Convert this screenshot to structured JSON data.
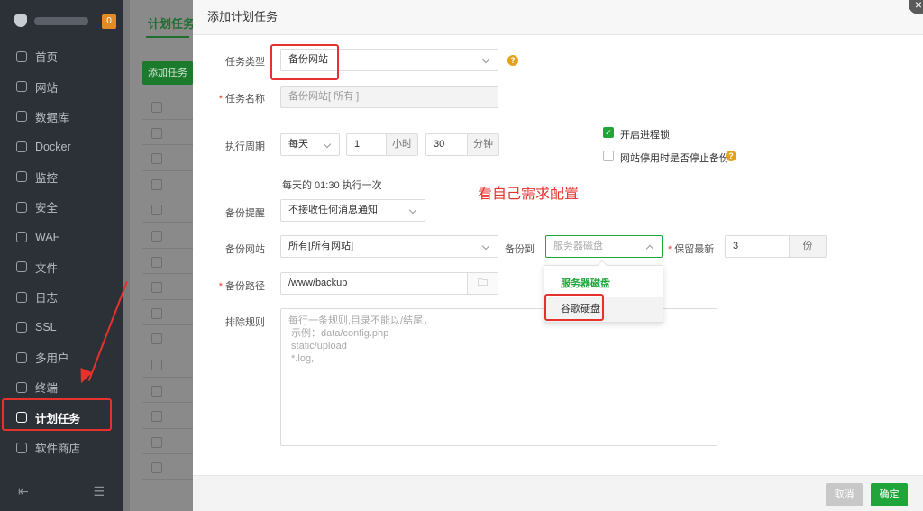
{
  "sidebar": {
    "badge": "0",
    "items": [
      {
        "label": "首页",
        "icon": "home-icon"
      },
      {
        "label": "网站",
        "icon": "globe-icon"
      },
      {
        "label": "数据库",
        "icon": "database-icon"
      },
      {
        "label": "Docker",
        "icon": "docker-icon"
      },
      {
        "label": "监控",
        "icon": "monitor-icon"
      },
      {
        "label": "安全",
        "icon": "shield-icon"
      },
      {
        "label": "WAF",
        "icon": "waf-icon"
      },
      {
        "label": "文件",
        "icon": "folder-icon"
      },
      {
        "label": "日志",
        "icon": "log-icon"
      },
      {
        "label": "SSL",
        "icon": "ssl-icon"
      },
      {
        "label": "多用户",
        "icon": "users-icon"
      },
      {
        "label": "终端",
        "icon": "terminal-icon"
      },
      {
        "label": "计划任务",
        "icon": "calendar-icon"
      },
      {
        "label": "软件商店",
        "icon": "store-icon"
      }
    ],
    "active_index": 12
  },
  "background": {
    "tab_label": "计划任务",
    "add_button": "添加任务"
  },
  "modal": {
    "title": "添加计划任务",
    "task_type": {
      "label": "任务类型",
      "value": "备份网站"
    },
    "task_name": {
      "label": "任务名称",
      "placeholder": "备份网站[ 所有 ]"
    },
    "cycle": {
      "label": "执行周期",
      "period": "每天",
      "hour": "1",
      "hour_unit": "小时",
      "minute": "30",
      "minute_unit": "分钟"
    },
    "process_lock": {
      "label": "开启进程锁",
      "checked": true
    },
    "stop_backup": {
      "label": "网站停用时是否停止备份",
      "checked": false
    },
    "schedule_hint": "每天的 01:30 执行一次",
    "note": "看自己需求配置",
    "reminder": {
      "label": "备份提醒",
      "value": "不接收任何消息通知"
    },
    "site": {
      "label": "备份网站",
      "value": "所有[所有网站]"
    },
    "backup_to": {
      "label": "备份到",
      "placeholder": "服务器磁盘"
    },
    "keep": {
      "label": "保留最新",
      "value": "3",
      "unit": "份"
    },
    "backup_path": {
      "label": "备份路径",
      "value": "/www/backup"
    },
    "exclude": {
      "label": "排除规则",
      "placeholder_lines": [
        "每行一条规则,目录不能以/结尾，",
        " 示例：data/config.php",
        " static/upload",
        " *.log,"
      ]
    },
    "dropdown_options": [
      "服务器磁盘",
      "谷歌硬盘"
    ],
    "cancel": "取消",
    "confirm": "确定"
  },
  "colors": {
    "accent": "#20a53a",
    "annotation": "#e5322d",
    "sidebar_bg": "#2c3138"
  }
}
